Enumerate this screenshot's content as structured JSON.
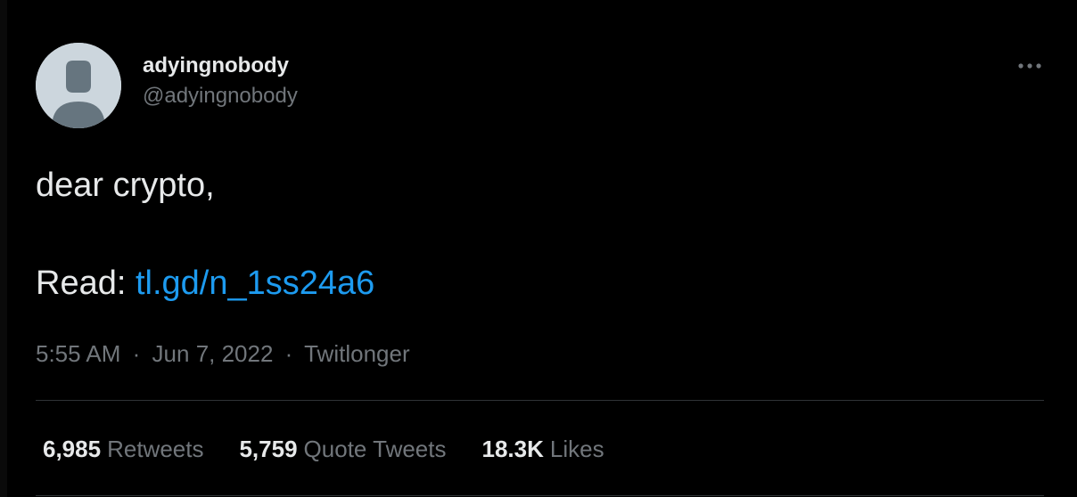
{
  "user": {
    "display_name": "adyingnobody",
    "handle": "@adyingnobody"
  },
  "tweet": {
    "line1": "dear crypto,",
    "read_prefix": "Read: ",
    "link_text": "tl.gd/n_1ss24a6"
  },
  "meta": {
    "time": "5:55 AM",
    "separator": "·",
    "date": "Jun 7, 2022",
    "source": "Twitlonger"
  },
  "stats": [
    {
      "count": "6,985",
      "label": "Retweets"
    },
    {
      "count": "5,759",
      "label": "Quote Tweets"
    },
    {
      "count": "18.3K",
      "label": "Likes"
    }
  ],
  "icons": {
    "avatar": "default-avatar-icon",
    "more": "more-horizontal-icon"
  },
  "colors": {
    "background": "#000000",
    "text": "#e7e9ea",
    "muted": "#71767b",
    "link": "#1d9bf0",
    "divider": "#2f3336"
  }
}
